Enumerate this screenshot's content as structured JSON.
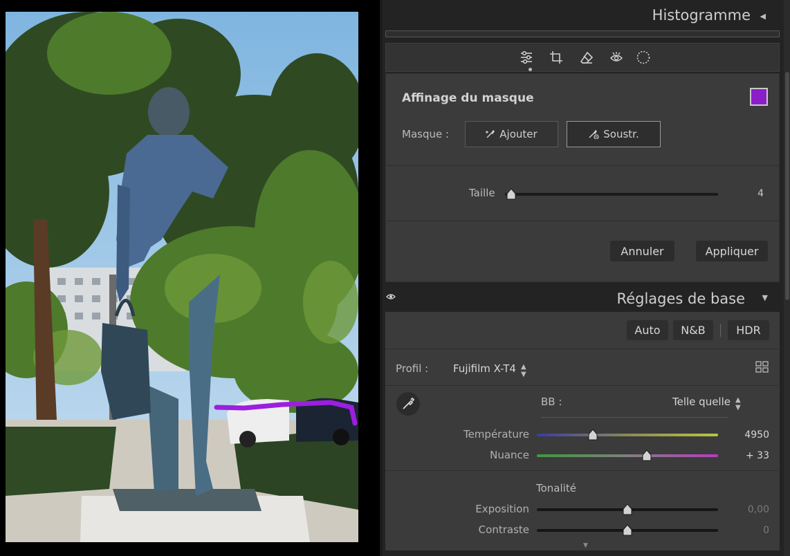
{
  "histogram": {
    "title": "Histogramme"
  },
  "toolstrip": {
    "tools": [
      "sliders-icon",
      "crop-icon",
      "eraser-icon",
      "redeye-icon",
      "radial-mask-icon"
    ]
  },
  "mask": {
    "title": "Affinage du masque",
    "swatch_color": "#8a1ec9",
    "masque_label": "Masque :",
    "add_label": "Ajouter",
    "subtract_label": "Soustr.",
    "size_label": "Taille",
    "size_value": "4",
    "size_level": 0.03,
    "cancel_label": "Annuler",
    "apply_label": "Appliquer"
  },
  "basic": {
    "title": "Réglages de base",
    "auto_label": "Auto",
    "bw_label": "N&B",
    "hdr_label": "HDR",
    "profile_label": "Profil :",
    "profile_value": "Fujifilm X-T4",
    "wb_label": "BB :",
    "wb_value": "Telle quelle",
    "temperature_label": "Température",
    "temperature_value": "4950",
    "temperature_level": 0.31,
    "tint_label": "Nuance",
    "tint_value": "+ 33",
    "tint_level": 0.605,
    "tone_label": "Tonalité",
    "exposure_label": "Exposition",
    "exposure_value": "0,00",
    "exposure_level": 0.5,
    "contrast_label": "Contraste",
    "contrast_value": "0",
    "contrast_level": 0.5
  }
}
